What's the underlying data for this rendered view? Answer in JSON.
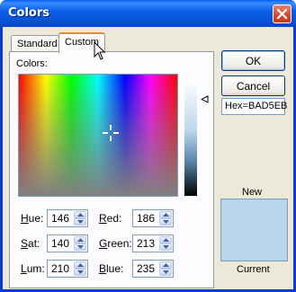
{
  "window": {
    "title": "Colors"
  },
  "tabs": {
    "standard": "Standard",
    "custom": "Custom"
  },
  "panel": {
    "colors_label": "Colors:"
  },
  "fields": {
    "hue": {
      "label_first": "H",
      "label_rest": "ue:",
      "value": "146"
    },
    "sat": {
      "label_first": "S",
      "label_rest": "at:",
      "value": "140"
    },
    "lum": {
      "label_first": "L",
      "label_rest": "um:",
      "value": "210"
    },
    "red": {
      "label_first": "R",
      "label_rest": "ed:",
      "value": "186"
    },
    "green": {
      "label_first": "G",
      "label_rest": "reen:",
      "value": "213"
    },
    "blue": {
      "label_first": "B",
      "label_rest": "lue:",
      "value": "235"
    }
  },
  "buttons": {
    "ok": "OK",
    "cancel": "Cancel"
  },
  "hex_text": "Hex=BAD5EB",
  "preview": {
    "new_label": "New",
    "current_label": "Current",
    "color": "#BAD5EB"
  },
  "colors": {
    "titlebar": "#0B5FE8",
    "client_bg": "#ECE9D8",
    "close": "#D9472B"
  }
}
